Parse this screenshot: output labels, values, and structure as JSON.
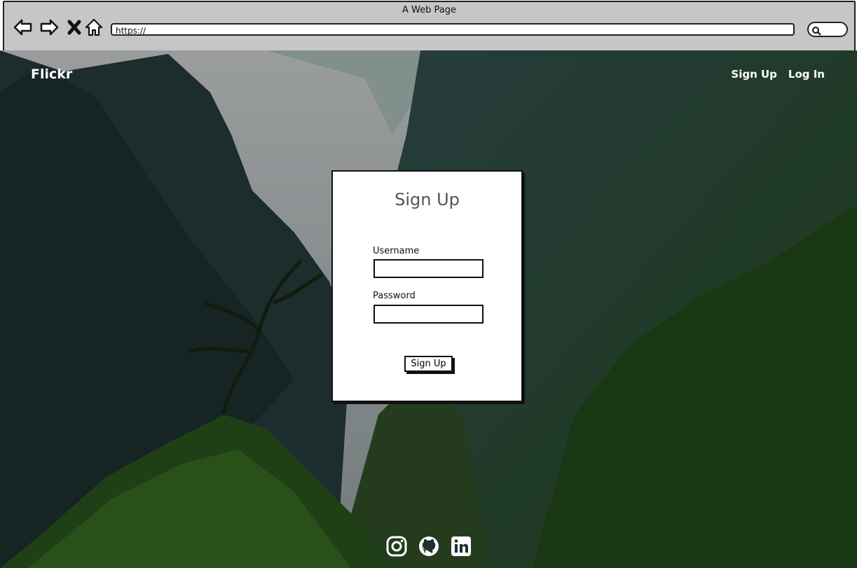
{
  "browser": {
    "window_title": "A Web Page",
    "url": "https://",
    "icons": [
      "back-icon",
      "forward-icon",
      "stop-icon",
      "home-icon",
      "search-icon"
    ]
  },
  "navbar": {
    "brand": "Flickr",
    "links": [
      "Sign Up",
      "Log In"
    ]
  },
  "form": {
    "title": "Sign Up",
    "username_label": "Username",
    "username_value": "",
    "password_label": "Password",
    "password_value": "",
    "submit_label": "Sign Up"
  },
  "footer": {
    "social_icons": [
      "instagram-icon",
      "github-icon",
      "linkedin-icon"
    ]
  },
  "colors": {
    "chrome_bg": "#c6c6c6",
    "page_bg": "#2c3b40",
    "text_light": "#ffffff"
  }
}
